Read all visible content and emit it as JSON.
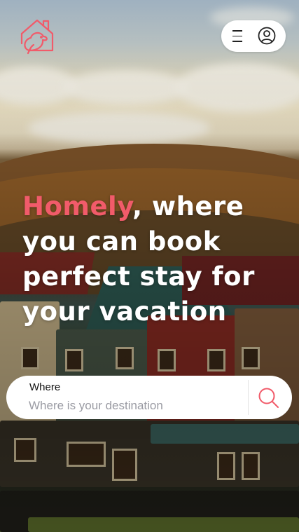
{
  "brand": {
    "name": "Homely",
    "logo_icon": "house-bird-logo-icon",
    "accent_color": "#f15b6a"
  },
  "header": {
    "menu_icon": "hamburger-menu-icon",
    "account_icon": "user-account-icon"
  },
  "hero": {
    "headline_brand": "Homely",
    "headline_rest": ", where you can book perfect stay for your vacation"
  },
  "search": {
    "label": "Where",
    "placeholder": "Where is your destination",
    "value": "",
    "button_icon": "search-icon"
  }
}
